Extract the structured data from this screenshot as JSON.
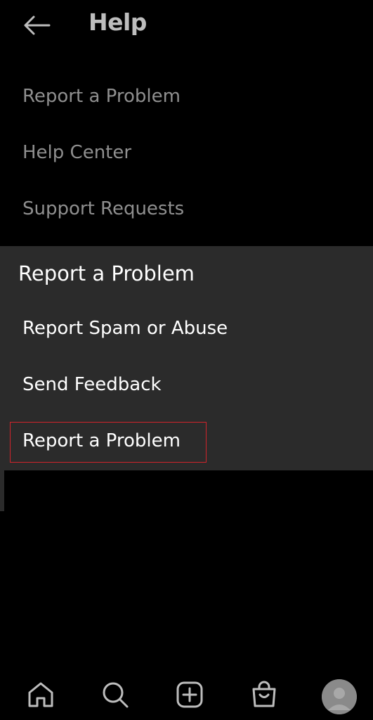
{
  "header": {
    "title": "Help",
    "back_icon": "arrow-left-icon"
  },
  "menu": {
    "items": [
      {
        "label": "Report a Problem"
      },
      {
        "label": "Help Center"
      },
      {
        "label": "Support Requests"
      }
    ]
  },
  "dialog": {
    "title": "Report a Problem",
    "options": [
      {
        "label": "Report Spam or Abuse"
      },
      {
        "label": "Send Feedback"
      },
      {
        "label": "Report a Problem",
        "highlighted": true
      }
    ],
    "highlight_color": "#d0242b",
    "background_color": "#2b2b2b"
  },
  "bottom_nav": {
    "items": [
      {
        "icon": "home-icon"
      },
      {
        "icon": "search-icon"
      },
      {
        "icon": "add-post-icon"
      },
      {
        "icon": "shop-icon"
      },
      {
        "icon": "profile-avatar"
      }
    ]
  }
}
